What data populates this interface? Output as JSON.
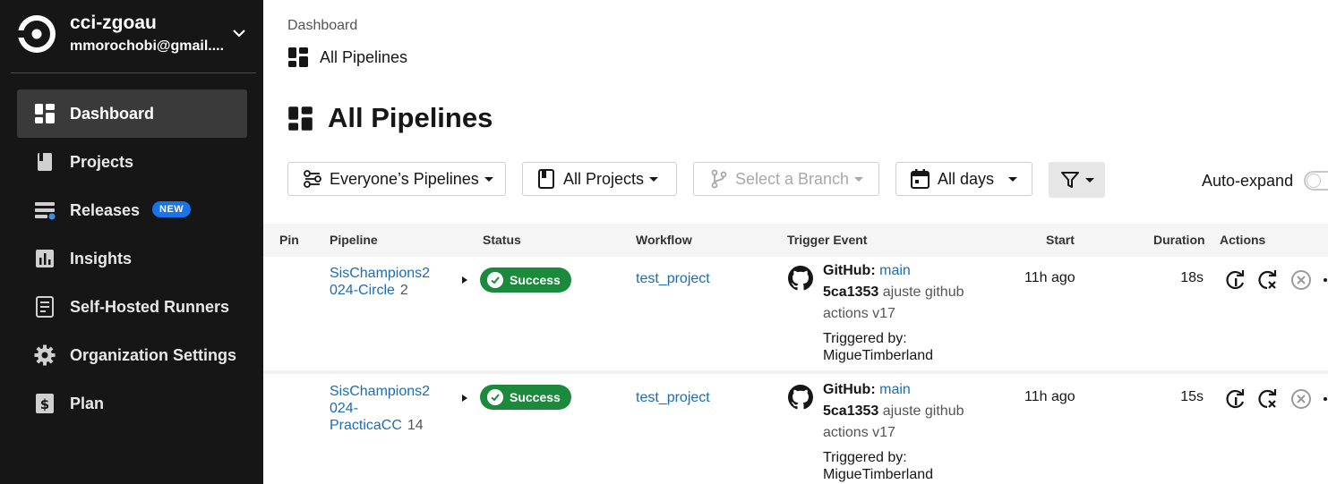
{
  "org": {
    "name": "cci-zgoau",
    "email": "mmorochobi@gmail...."
  },
  "sidebar": {
    "items": [
      {
        "label": "Dashboard",
        "icon": "dashboard-icon",
        "active": true
      },
      {
        "label": "Projects",
        "icon": "book-icon"
      },
      {
        "label": "Releases",
        "icon": "releases-icon",
        "badge": "NEW"
      },
      {
        "label": "Insights",
        "icon": "insights-icon"
      },
      {
        "label": "Self-Hosted Runners",
        "icon": "runners-icon"
      },
      {
        "label": "Organization Settings",
        "icon": "gear-icon"
      },
      {
        "label": "Plan",
        "icon": "dollar-icon"
      }
    ]
  },
  "breadcrumb": {
    "parent": "Dashboard",
    "current": "All Pipelines"
  },
  "page": {
    "title": "All Pipelines"
  },
  "filters": {
    "pipelines": "Everyone’s Pipelines",
    "projects": "All Projects",
    "branch": "Select a Branch",
    "days": "All days",
    "auto_expand": "Auto-expand"
  },
  "table": {
    "headers": {
      "pin": "Pin",
      "pipeline": "Pipeline",
      "status": "Status",
      "workflow": "Workflow",
      "trigger": "Trigger Event",
      "start": "Start",
      "duration": "Duration",
      "actions": "Actions"
    },
    "rows": [
      {
        "pipeline_line1": "SisChampions2",
        "pipeline_line2": "024-Circle",
        "pipeline_line3": "",
        "number": "2",
        "status": "Success",
        "workflow": "test_project",
        "trigger_source": "GitHub:",
        "branch": "main",
        "commit_hash": "5ca1353",
        "commit_msg_1": "ajuste github",
        "commit_msg_2": "actions v17",
        "triggered_by_label": "Triggered by:",
        "triggered_by": "MigueTimberland",
        "start": "11h ago",
        "duration": "18s"
      },
      {
        "pipeline_line1": "SisChampions2",
        "pipeline_line2": "024-",
        "pipeline_line3": "PracticaCC",
        "number": "14",
        "status": "Success",
        "workflow": "test_project",
        "trigger_source": "GitHub:",
        "branch": "main",
        "commit_hash": "5ca1353",
        "commit_msg_1": "ajuste github",
        "commit_msg_2": "actions v17",
        "triggered_by_label": "Triggered by:",
        "triggered_by": "MigueTimberland",
        "start": "11h ago",
        "duration": "15s"
      }
    ]
  },
  "colors": {
    "sidebar_bg": "#161616",
    "success": "#1b8a3c",
    "link": "#1a6db5",
    "badge": "#1a73e8"
  }
}
